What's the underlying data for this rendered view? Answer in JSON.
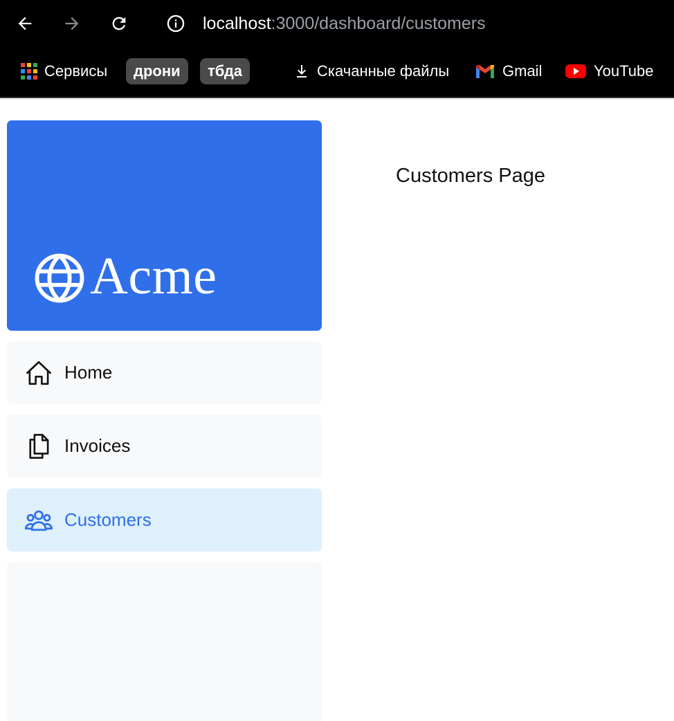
{
  "browser": {
    "url_host": "localhost",
    "url_path": ":3000/dashboard/customers",
    "icons": {
      "back": "arrow-left-icon",
      "forward": "arrow-right-icon",
      "reload": "reload-icon",
      "site_info": "info-icon"
    },
    "bookmarks": {
      "apps_label": "Сервисы",
      "folder1": "дрони",
      "folder2": "тбда",
      "downloads_label": "Скачанные файлы",
      "gmail_label": "Gmail",
      "youtube_label": "YouTube"
    }
  },
  "sidebar": {
    "logo_text": "Acme",
    "logo_color": "#2f6fea",
    "nav": {
      "home": "Home",
      "invoices": "Invoices",
      "customers": "Customers"
    },
    "active_item": "customers",
    "active_bg": "#dff0fd",
    "active_color": "#2f6fea"
  },
  "main": {
    "heading": "Customers Page"
  }
}
